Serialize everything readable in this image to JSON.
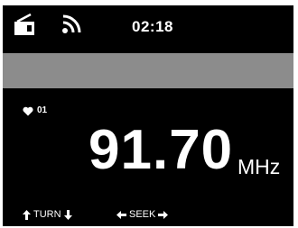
{
  "status": {
    "clock": "02:18",
    "icons": [
      "radio-icon",
      "signal-icon"
    ]
  },
  "preset": {
    "icon": "heart-icon",
    "number": "01"
  },
  "frequency": {
    "value": "91.70",
    "unit": "MHz"
  },
  "hints": {
    "turn_label": "TURN",
    "seek_label": "SEEK"
  },
  "colors": {
    "screen": "#000000",
    "band": "#8c8c8c",
    "text": "#ffffff"
  }
}
